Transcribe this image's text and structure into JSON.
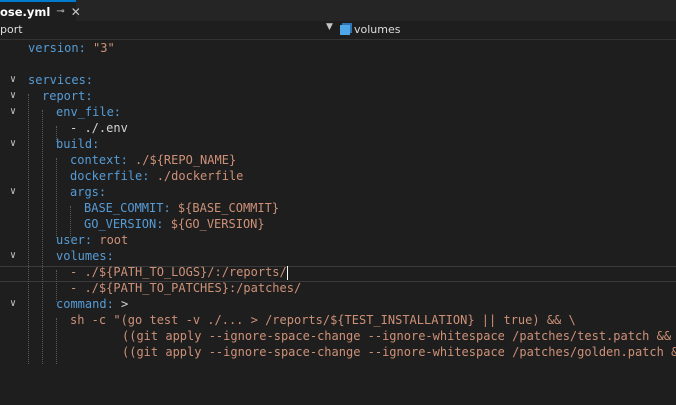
{
  "tab": {
    "title": "ose.yml",
    "pin": "⊸",
    "close": "✕"
  },
  "navbar": {
    "left": "port",
    "right": "volumes"
  },
  "lines": [
    [
      "version: ",
      "\"3\""
    ],
    [
      "services:",
      ""
    ],
    [
      "report:",
      ""
    ],
    [
      "env_file:",
      ""
    ],
    [
      "- ./.env",
      ""
    ],
    [
      "build:",
      ""
    ],
    [
      "context: ",
      "./${REPO_NAME}"
    ],
    [
      "dockerfile: ",
      "./dockerfile"
    ],
    [
      "args:",
      ""
    ],
    [
      "BASE_COMMIT: ",
      "${BASE_COMMIT}"
    ],
    [
      "GO_VERSION: ",
      "${GO_VERSION}"
    ],
    [
      "user: ",
      "root"
    ],
    [
      "volumes:",
      ""
    ],
    [
      "- ./${PATH_TO_LOGS}/:/reports/",
      ""
    ],
    [
      "- ./${PATH_TO_PATCHES}:/patches/",
      ""
    ],
    [
      "command: ",
      ">"
    ],
    [
      "sh -c \"(go test -v ./... > /reports/${TEST_INSTALLATION} || true) && \\",
      ""
    ],
    [
      "((git apply --ignore-space-change --ignore-whitespace /patches/test.patch && ",
      ""
    ],
    [
      "((git apply --ignore-space-change --ignore-whitespace /patches/golden.patch &",
      ""
    ]
  ]
}
